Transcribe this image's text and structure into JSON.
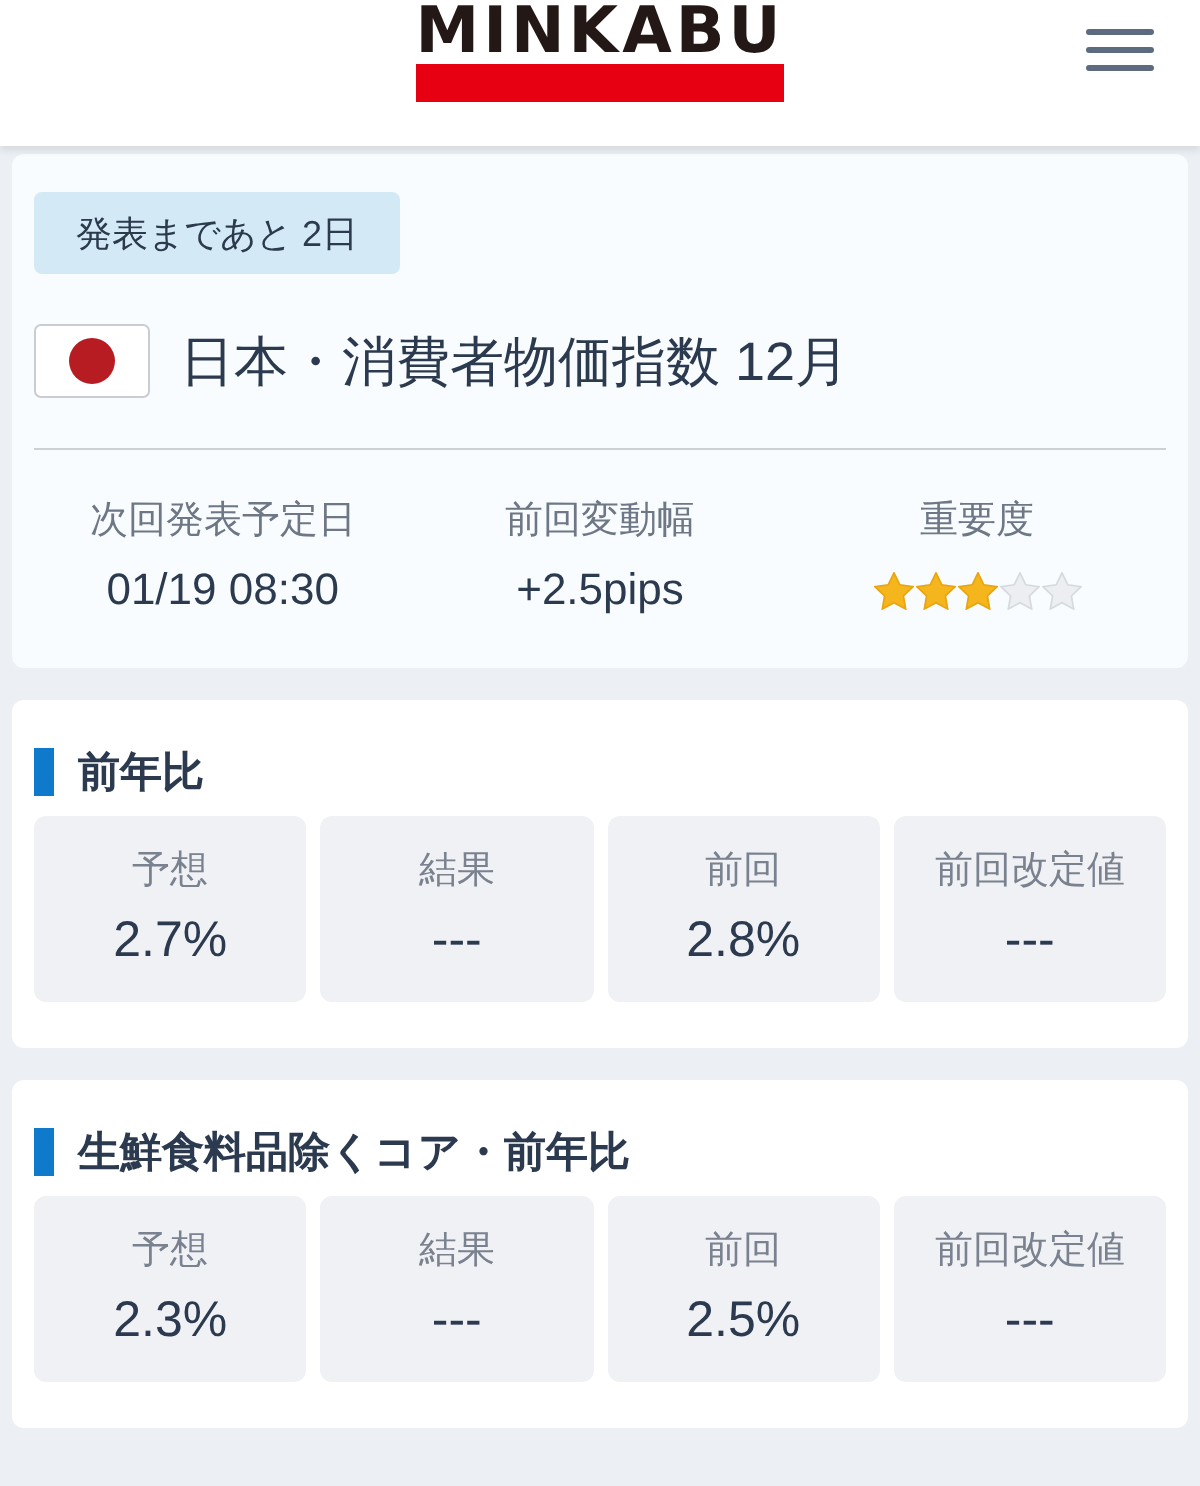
{
  "header": {
    "logo": "MINKABU"
  },
  "event": {
    "countdown_badge": "発表まであと 2日",
    "title": "日本・消費者物価指数 12月",
    "details": [
      {
        "kind": "text",
        "label": "次回発表予定日",
        "value": "01/19 08:30"
      },
      {
        "kind": "text",
        "label": "前回変動幅",
        "value": "+2.5pips"
      },
      {
        "kind": "stars",
        "label": "重要度",
        "stars": 3
      }
    ]
  },
  "sections": [
    {
      "heading": "前年比",
      "cells": [
        {
          "label": "予想",
          "value": "2.7%"
        },
        {
          "label": "結果",
          "value": "---"
        },
        {
          "label": "前回",
          "value": "2.8%"
        },
        {
          "label": "前回改定値",
          "value": "---"
        }
      ]
    },
    {
      "heading": "生鮮食料品除くコア・前年比",
      "cells": [
        {
          "label": "予想",
          "value": "2.3%"
        },
        {
          "label": "結果",
          "value": "---"
        },
        {
          "label": "前回",
          "value": "2.5%"
        },
        {
          "label": "前回改定値",
          "value": "---"
        }
      ]
    }
  ]
}
